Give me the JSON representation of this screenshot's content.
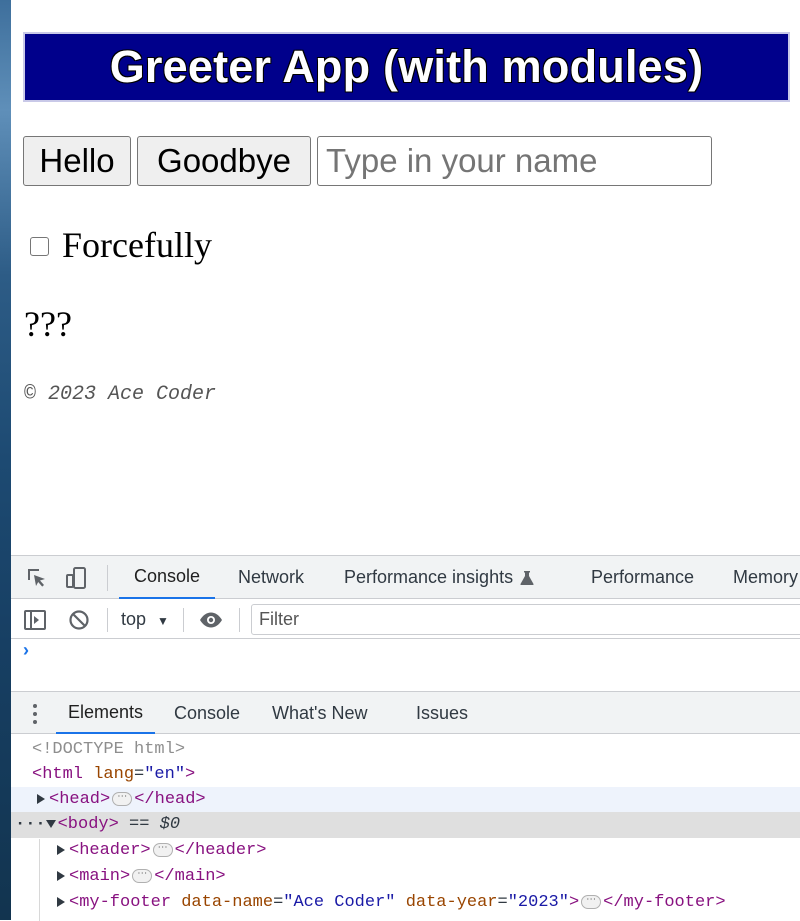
{
  "app": {
    "title": "Greeter App (with modules)",
    "hello_label": "Hello",
    "goodbye_label": "Goodbye",
    "name_placeholder": "Type in your name",
    "forcefully_label": "Forcefully",
    "greeting_text": "???",
    "footer_text": "© 2023 Ace Coder"
  },
  "devtools": {
    "tabs": [
      "Console",
      "Network",
      "Performance insights",
      "Performance",
      "Memory"
    ],
    "active_tab": "Console",
    "context": "top",
    "filter_placeholder": "Filter",
    "prompt": "›",
    "drawer_tabs": [
      "Elements",
      "Console",
      "What's New",
      "Issues"
    ],
    "dom": {
      "doctype": "<!DOCTYPE html>",
      "html_open": "<html",
      "html_attr_name": "lang",
      "html_attr_value": "\"en\"",
      "head_open": "<head>",
      "head_close": "</head>",
      "body_open": "<body>",
      "body_eq": " == ",
      "body_ref": "$0",
      "header_open": "<header>",
      "header_close": "</header>",
      "main_open": "<main>",
      "main_close": "</main>",
      "footer_open": "<my-footer",
      "footer_attr1_name": "data-name",
      "footer_attr1_value": "\"Ace Coder\"",
      "footer_attr2_name": "data-year",
      "footer_attr2_value": "\"2023\"",
      "footer_close": "</my-footer>"
    }
  },
  "colors": {
    "header_bg": "#00008b",
    "link_blue": "#1a73e8",
    "tag": "#881280",
    "attr_name": "#994500",
    "attr_value": "#1a1aa6"
  }
}
